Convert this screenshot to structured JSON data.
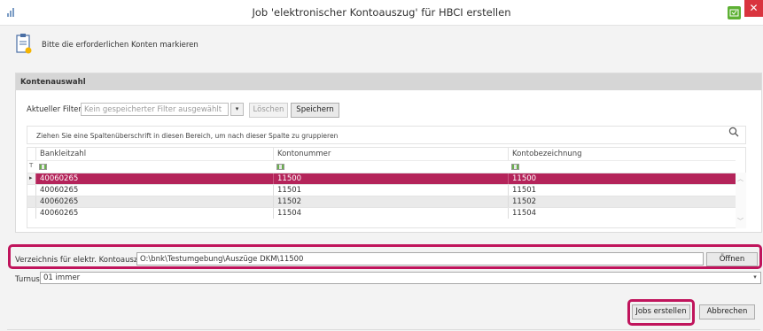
{
  "window": {
    "title": "Job 'elektronischer Kontoauszug' für HBCI erstellen",
    "close_glyph": "✕",
    "icons": {
      "app": "chart-bars-icon",
      "help": "green-help-icon",
      "close": "close-icon"
    }
  },
  "instruction": "Bitte die erforderlichen Konten markieren",
  "panel": {
    "title": "Kontenauswahl",
    "filter": {
      "label": "Aktueller Filter:",
      "placeholder": "Kein gespeicherter Filter ausgewählt",
      "dropdown_glyph": "▾",
      "delete_label": "Löschen",
      "save_label": "Speichern"
    },
    "group_hint": "Ziehen Sie eine Spaltenüberschrift in diesen Bereich, um nach dieser Spalte zu gruppieren",
    "columns": [
      "Bankleitzahl",
      "Kontonummer",
      "Kontobezeichnung"
    ],
    "filter_row_marker": "T",
    "row_marker": "▸",
    "rows": [
      {
        "blz": "40060265",
        "konto": "11500",
        "bez": "11500"
      },
      {
        "blz": "40060265",
        "konto": "11501",
        "bez": "11501"
      },
      {
        "blz": "40060265",
        "konto": "11502",
        "bez": "11502"
      },
      {
        "blz": "40060265",
        "konto": "11504",
        "bez": "11504"
      }
    ],
    "scroll_up": "︿",
    "scroll_down": "﹀"
  },
  "directory": {
    "label": "Verzeichnis für elektr. Kontoauszug",
    "value": "O:\\bnk\\Testumgebung\\Auszüge DKM\\11500",
    "open_label": "Öffnen"
  },
  "turnus": {
    "label": "Turnus",
    "value": "01 immer",
    "dropdown_glyph": "▾"
  },
  "actions": {
    "create_jobs": "Jobs erstellen",
    "cancel": "Abbrechen"
  },
  "colors": {
    "selection": "#b4245a",
    "highlight": "#c0145c",
    "close": "#d9343e",
    "help": "#5eb134"
  }
}
